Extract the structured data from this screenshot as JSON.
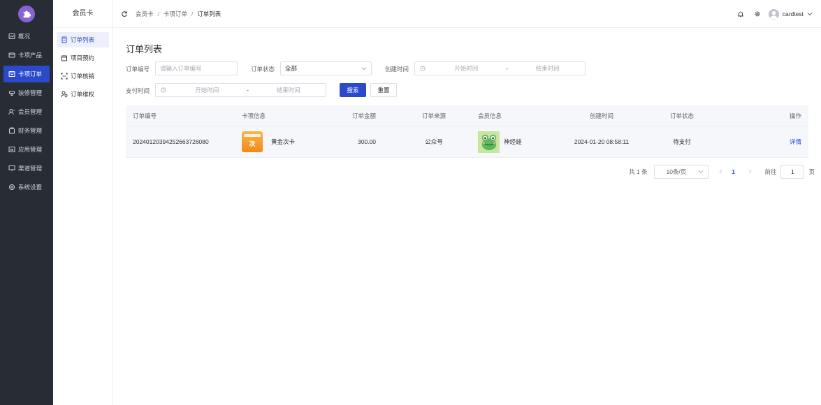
{
  "sidebar": {
    "items": [
      {
        "label": "概况",
        "icon": "dashboard-icon"
      },
      {
        "label": "卡项产品",
        "icon": "card-icon"
      },
      {
        "label": "卡项订单",
        "icon": "order-icon",
        "active": true
      },
      {
        "label": "装修管理",
        "icon": "decorate-icon"
      },
      {
        "label": "会员管理",
        "icon": "member-icon"
      },
      {
        "label": "财务管理",
        "icon": "finance-icon"
      },
      {
        "label": "应用管理",
        "icon": "app-icon"
      },
      {
        "label": "渠道管理",
        "icon": "channel-icon"
      },
      {
        "label": "系统设置",
        "icon": "settings-icon"
      }
    ]
  },
  "subsidebar": {
    "title": "会员卡",
    "items": [
      {
        "label": "订单列表",
        "active": true
      },
      {
        "label": "项目预约"
      },
      {
        "label": "订单核销"
      },
      {
        "label": "订单维权"
      }
    ]
  },
  "header": {
    "breadcrumb": [
      "会员卡",
      "卡项订单",
      "订单列表"
    ],
    "separator": "/",
    "username": "cardtest"
  },
  "page": {
    "title": "订单列表"
  },
  "filters": {
    "order_no_label": "订单编号",
    "order_no_placeholder": "请输入订单编号",
    "status_label": "订单状态",
    "status_value": "全部",
    "created_label": "创建时间",
    "created_start": "开始时间",
    "created_end": "结束时间",
    "paid_label": "支付时间",
    "paid_start": "开始时间",
    "paid_end": "结束时间",
    "range_sep": "-",
    "search_button": "搜索",
    "reset_button": "重置"
  },
  "table": {
    "columns": [
      "订单编号",
      "卡项信息",
      "订单金额",
      "订单来源",
      "会员信息",
      "创建时间",
      "订单状态",
      "操作"
    ],
    "rows": [
      {
        "order_no": "20240120394252663726080",
        "card_name": "黄金次卡",
        "card_glyph": "次",
        "amount": "300.00",
        "source": "公众号",
        "member": "神经蛙",
        "created": "2024-01-20 08:58:11",
        "status": "待支付",
        "action": "详情"
      }
    ]
  },
  "pagination": {
    "total": "共 1 条",
    "page_size": "10条/页",
    "current_page": "1",
    "goto_label": "前往",
    "goto_value": "1",
    "page_suffix": "页"
  },
  "colors": {
    "primary": "#2b4acb",
    "sidebar_bg": "#282c34",
    "logo": "#8a63d2"
  }
}
